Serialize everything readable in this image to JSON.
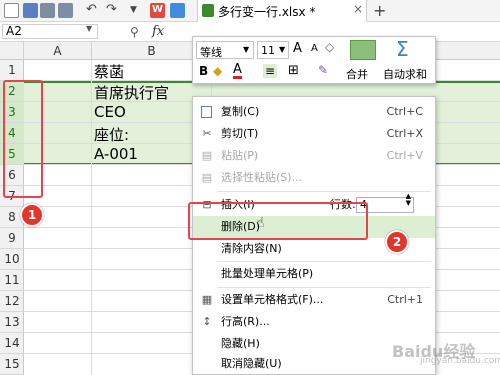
{
  "app": {
    "accent": "#3c8a2e",
    "document_tab": "多行变一行.xlsx *",
    "quick_access_icons": [
      "document-icon",
      "save-icon",
      "print-icon",
      "print-preview-icon",
      "undo-icon",
      "redo-icon",
      "dropdown-icon",
      "wps-logo-icon",
      "cube-icon"
    ]
  },
  "formula_bar": {
    "name_box": "A2",
    "fx": "fx"
  },
  "columns": [
    "A",
    "B"
  ],
  "rows": [
    "1",
    "2",
    "3",
    "4",
    "5",
    "6",
    "7",
    "8",
    "9",
    "10",
    "11",
    "12",
    "13",
    "14",
    "15"
  ],
  "cells": {
    "B1": "蔡菡",
    "B2": "首席执行官",
    "B3": "CEO",
    "B4": "座位:",
    "B5": "A-001"
  },
  "mini_toolbar": {
    "font_name": "等线",
    "font_size": "11",
    "grow_font": "A",
    "shrink_font": "A",
    "bold": "B",
    "font_color": "A",
    "merge_label": "合并",
    "autosum_label": "自动求和"
  },
  "context_menu": {
    "items": [
      {
        "label": "复制(C)",
        "shortcut": "Ctrl+C",
        "icon": "copy-icon"
      },
      {
        "label": "剪切(T)",
        "shortcut": "Ctrl+X",
        "icon": "scissors-icon"
      },
      {
        "label": "粘贴(P)",
        "shortcut": "Ctrl+V",
        "icon": "paste-icon",
        "disabled": true
      },
      {
        "label": "选择性粘贴(S)...",
        "shortcut": "",
        "icon": "paste-special-icon",
        "disabled": true
      },
      {
        "label": "插入(I)",
        "shortcut": "",
        "icon": "insert-icon"
      },
      {
        "label": "删除(D)",
        "shortcut": "",
        "icon": ""
      },
      {
        "label": "清除内容(N)",
        "shortcut": "",
        "icon": ""
      },
      {
        "label": "批量处理单元格(P)",
        "shortcut": "",
        "icon": ""
      },
      {
        "label": "设置单元格格式(F)...",
        "shortcut": "Ctrl+1",
        "icon": "format-cells-icon"
      },
      {
        "label": "行高(R)...",
        "shortcut": "",
        "icon": "row-height-icon"
      },
      {
        "label": "隐藏(H)",
        "shortcut": "",
        "icon": ""
      },
      {
        "label": "取消隐藏(U)",
        "shortcut": "",
        "icon": ""
      }
    ],
    "insert_rows_label": "行数:",
    "insert_rows_value": "4"
  },
  "annotations": {
    "badge1": "1",
    "badge2": "2"
  },
  "watermark": {
    "main": "Baidu经验",
    "sub": "jingyan.baidu.com"
  }
}
